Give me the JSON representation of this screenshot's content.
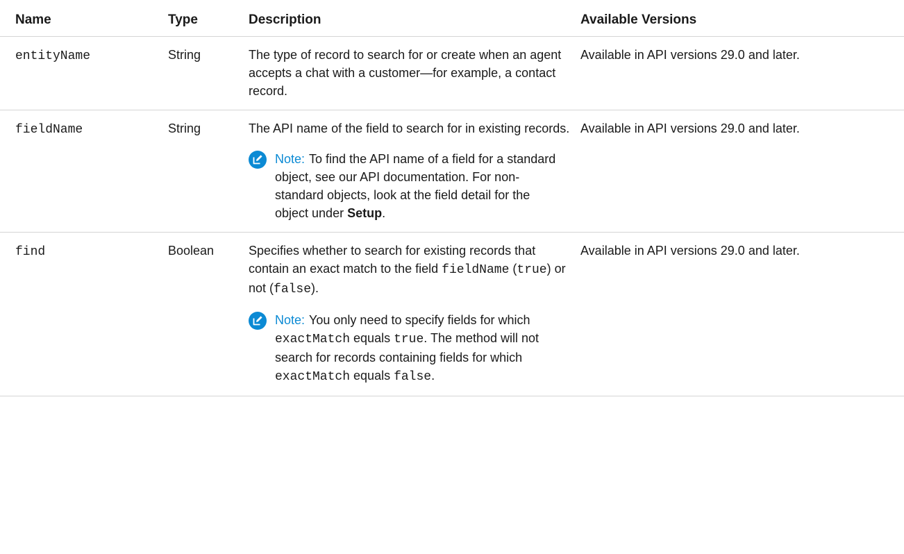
{
  "table": {
    "headers": {
      "name": "Name",
      "type": "Type",
      "description": "Description",
      "versions": "Available Versions"
    },
    "rows": [
      {
        "name": "entityName",
        "type": "String",
        "description": "The type of record to search for or create when an agent accepts a chat with a customer—for example, a contact record.",
        "versions": "Available in API versions 29.0 and later."
      },
      {
        "name": "fieldName",
        "type": "String",
        "description": "The API name of the field to search for in existing records.",
        "note": {
          "label": "Note:",
          "text_before": "To find the API name of a field for a standard object, see our API documentation. For non-standard objects, look at the field detail for the object under ",
          "strong": "Setup",
          "text_after": "."
        },
        "versions": "Available in API versions 29.0 and later."
      },
      {
        "name": "find",
        "type": "Boolean",
        "description": {
          "text1": "Specifies whether to search for existing records that contain an exact match to the field ",
          "code1": "fieldName",
          "text2": " (",
          "code2": "true",
          "text3": ") or not (",
          "code3": "false",
          "text4": ")."
        },
        "note": {
          "label": "Note:",
          "text1": "You only need to specify fields for which ",
          "code1": "exactMatch",
          "text2": " equals ",
          "code2": "true",
          "text3": ". The method will not search for records containing fields for which ",
          "code3": "exactMatch",
          "text4": " equals ",
          "code4": "false",
          "text5": "."
        },
        "versions": "Available in API versions 29.0 and later."
      }
    ]
  },
  "icons": {
    "note_icon": "note-edit-icon",
    "note_color": "#0b8ad4"
  }
}
